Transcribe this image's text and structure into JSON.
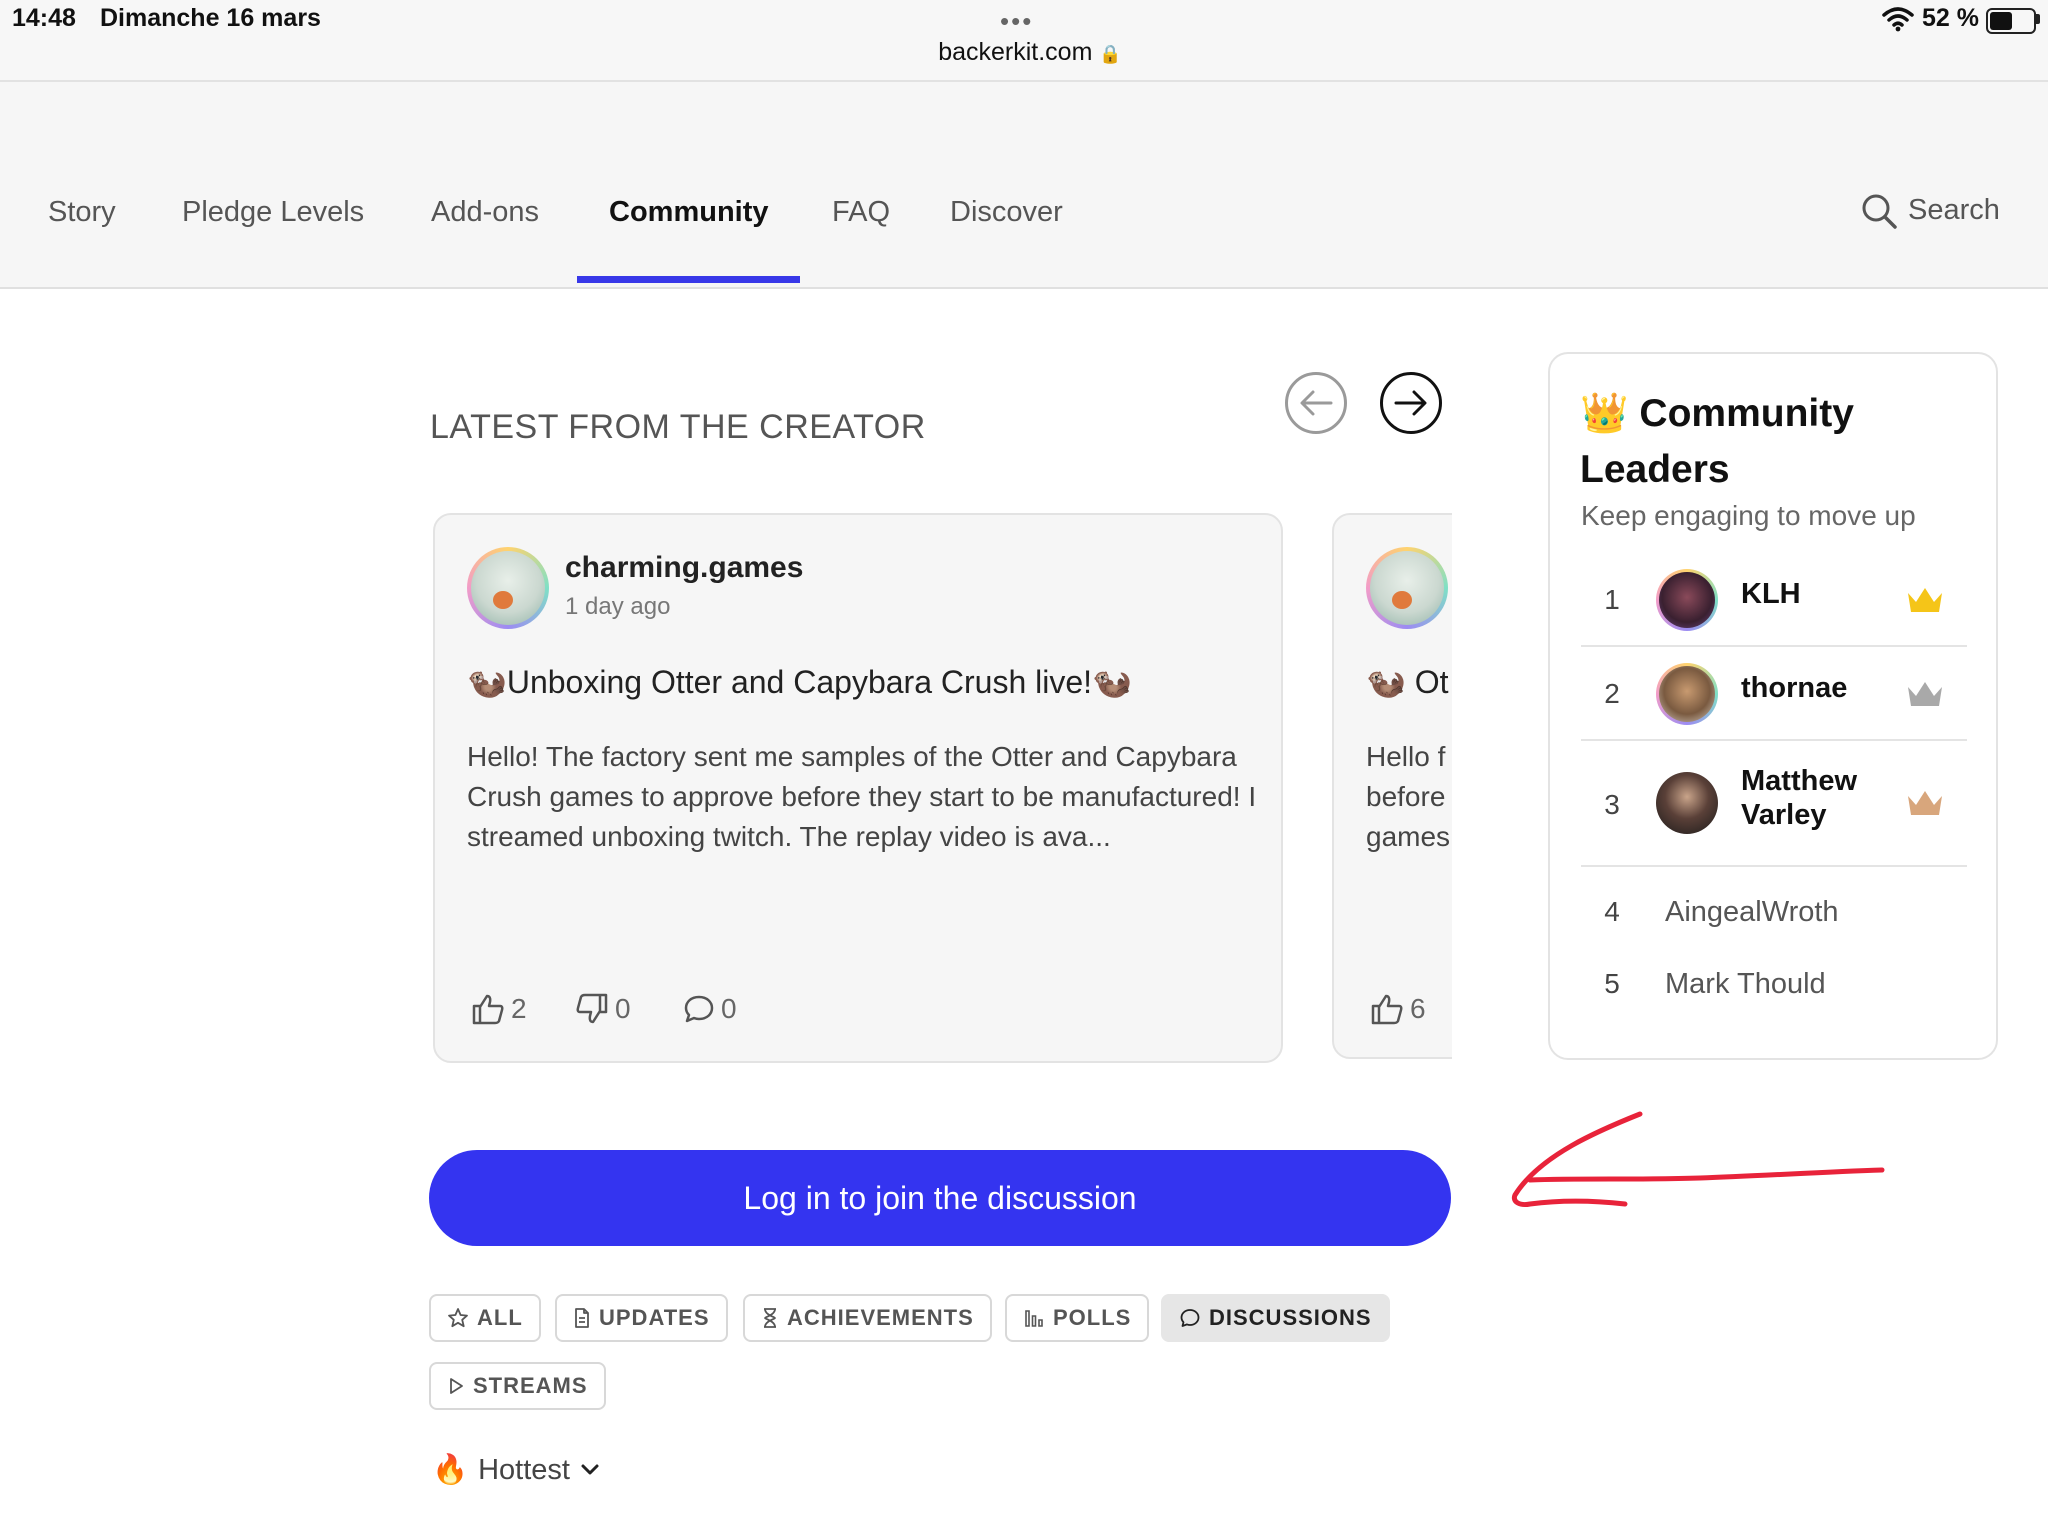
{
  "status_bar": {
    "time": "14:48",
    "date": "Dimanche 16 mars",
    "url": "backerkit.com",
    "battery": "52 %",
    "battery_level": 0.52
  },
  "nav": {
    "items": [
      "Story",
      "Pledge Levels",
      "Add-ons",
      "Community",
      "FAQ",
      "Discover"
    ],
    "active": "Community",
    "search_label": "Search"
  },
  "creator_section": {
    "title": "LATEST FROM THE CREATOR",
    "posts": [
      {
        "author": "charming.games",
        "time": "1 day ago",
        "title": "Unboxing Otter and Capybara Crush live!",
        "title_emoji": "🦦",
        "body": "Hello!  The factory sent me samples of the Otter and Capybara Crush games to approve before they start to be manufactured! I streamed unboxing twitch. The replay video is ava...",
        "likes": "2",
        "dislikes": "0",
        "comments": "0"
      },
      {
        "title_partial": "Ot",
        "body_partial": [
          "Hello f",
          "before",
          "games"
        ],
        "likes": "6"
      }
    ]
  },
  "leaders": {
    "emoji": "👑",
    "title": "Community Leaders",
    "subtitle": "Keep engaging to move up",
    "top": [
      {
        "rank": "1",
        "name": "KLH",
        "crown_color": "#f5c518"
      },
      {
        "rank": "2",
        "name": "thornae",
        "crown_color": "#a9a9a9"
      },
      {
        "rank": "3",
        "name": "Matthew Varley",
        "crown_color": "#d8a67c"
      }
    ],
    "others": [
      {
        "rank": "4",
        "name": "AingealWroth"
      },
      {
        "rank": "5",
        "name": "Mark Thould"
      }
    ]
  },
  "cta": {
    "label": "Log in to join the discussion",
    "color": "#3434f0"
  },
  "filters": [
    {
      "label": "ALL",
      "icon": "star-icon"
    },
    {
      "label": "UPDATES",
      "icon": "document-icon"
    },
    {
      "label": "ACHIEVEMENTS",
      "icon": "hourglass-icon"
    },
    {
      "label": "POLLS",
      "icon": "bar-chart-icon"
    },
    {
      "label": "DISCUSSIONS",
      "icon": "speech-bubble-icon",
      "active": true
    },
    {
      "label": "STREAMS",
      "icon": "play-icon"
    }
  ],
  "sort": {
    "emoji": "🔥",
    "label": "Hottest"
  }
}
